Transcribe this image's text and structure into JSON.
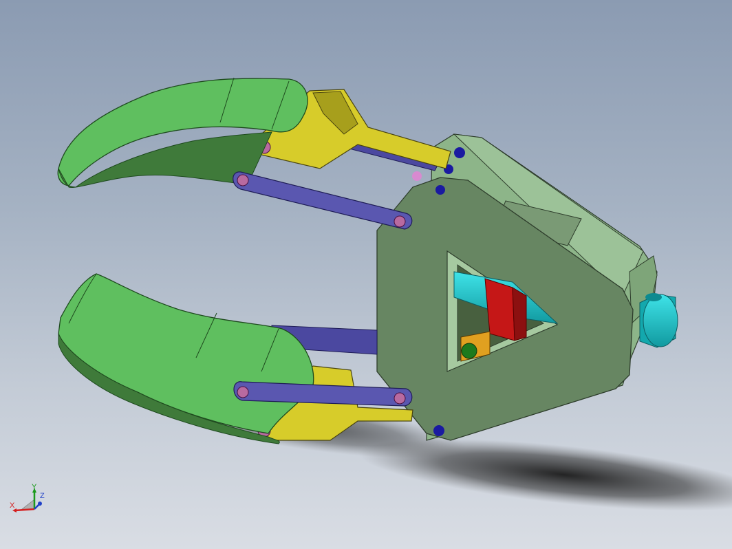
{
  "viewport": {
    "background_top": "#8b9bb2",
    "background_bottom": "#d9dde4"
  },
  "model": {
    "colors": {
      "jaw": "#5fbf5f",
      "jaw_dark": "#3f7a3a",
      "yoke": "#d7cc2a",
      "link": "#5a57b0",
      "housing": "#8fb58a",
      "housing_face": "#6b8a66",
      "plunger": "#1cc0c6",
      "block": "#c81818",
      "pin": "#1a1aa0",
      "pin_pink": "#b86aa0"
    }
  },
  "triad": {
    "x_label": "X",
    "y_label": "Y",
    "z_label": "Z",
    "x_color": "#d42020",
    "y_color": "#1a9a1a",
    "z_color": "#2040c8"
  }
}
